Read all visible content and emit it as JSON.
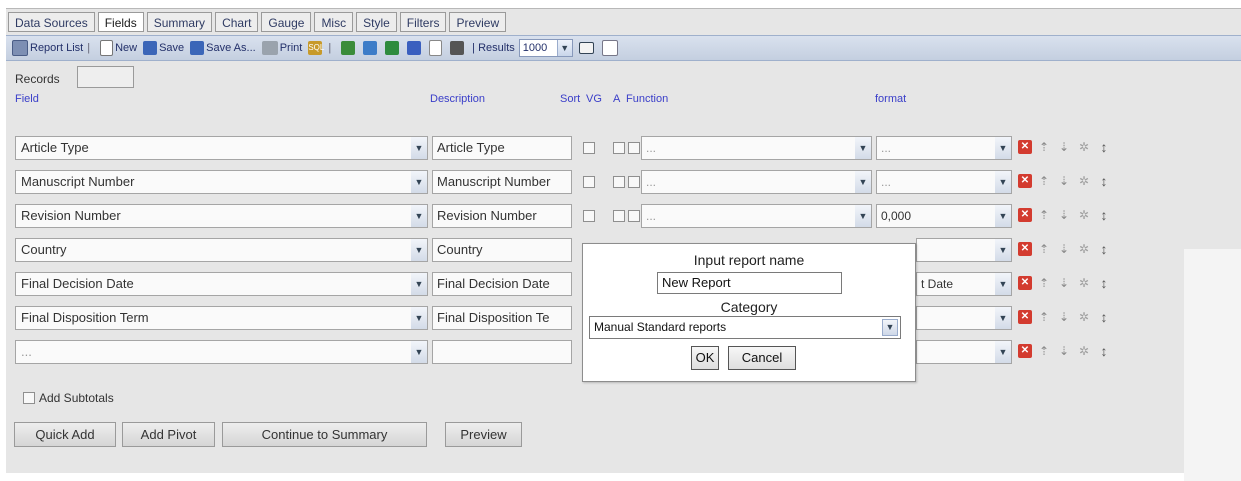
{
  "tabs": [
    "Data Sources",
    "Fields",
    "Summary",
    "Chart",
    "Gauge",
    "Misc",
    "Style",
    "Filters",
    "Preview"
  ],
  "active_tab": "Fields",
  "toolbar": {
    "report_list": "Report List",
    "new": "New",
    "save": "Save",
    "save_as": "Save As...",
    "print": "Print",
    "results_label": "| Results",
    "results_value": "1000",
    "sql_icon": "sql-icon",
    "export_icons": [
      "export-excel-icon",
      "chart-export-icon",
      "excel-icon",
      "word-icon",
      "document-icon",
      "database-icon"
    ],
    "mail_icon": "envelope-icon",
    "calendar_icon": "calendar-icon"
  },
  "records_label": "Records",
  "headers": {
    "field": "Field",
    "description": "Description",
    "sort": "Sort",
    "vg": "VG",
    "a": "A",
    "function": "Function",
    "format": "format"
  },
  "rows": [
    {
      "field": "Article Type",
      "description": "Article Type",
      "function": "...",
      "format": "..."
    },
    {
      "field": "Manuscript Number",
      "description": "Manuscript Number",
      "function": "...",
      "format": "..."
    },
    {
      "field": "Revision Number",
      "description": "Revision Number",
      "function": "...",
      "format": "0,000"
    },
    {
      "field": "Country",
      "description": "Country",
      "function": "",
      "format": ""
    },
    {
      "field": "Final Decision Date",
      "description": "Final Decision Date",
      "function": "",
      "format": "t Date"
    },
    {
      "field": "Final Disposition Term",
      "description": "Final Disposition Te",
      "function": "",
      "format": ""
    },
    {
      "field": "...",
      "description": "",
      "function": "",
      "format": ""
    }
  ],
  "add_subtotals": "Add Subtotals",
  "buttons": {
    "quick_add": "Quick Add",
    "add_pivot": "Add Pivot",
    "continue_summary": "Continue to Summary",
    "preview": "Preview"
  },
  "modal": {
    "title": "Input report name",
    "report_name": "New Report",
    "category_label": "Category",
    "category_value": "Manual Standard reports",
    "ok": "OK",
    "cancel": "Cancel"
  },
  "colors": {
    "tab_text": "#2f3b63",
    "header_text": "#3a3ec9",
    "delete_icon": "#d33b2f"
  }
}
